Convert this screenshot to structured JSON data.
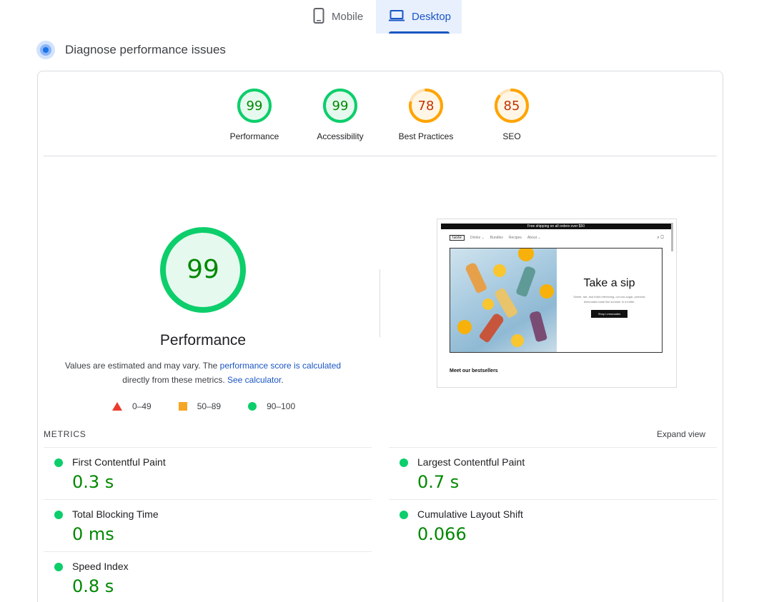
{
  "tabs": [
    {
      "label": "Mobile",
      "icon": "smartphone-icon"
    },
    {
      "label": "Desktop",
      "icon": "laptop-icon",
      "active": true
    }
  ],
  "diagnose": {
    "title": "Diagnose performance issues",
    "icon": "lighthouse-icon"
  },
  "categories": [
    {
      "score": "99",
      "label": "Performance",
      "value": 99,
      "color": "#0cce6b"
    },
    {
      "score": "99",
      "label": "Accessibility",
      "value": 99,
      "color": "#0cce6b"
    },
    {
      "score": "78",
      "label": "Best Practices",
      "value": 78,
      "color": "#ffa400"
    },
    {
      "score": "85",
      "label": "SEO",
      "value": 85,
      "color": "#ffa400"
    }
  ],
  "performance": {
    "score": "99",
    "value": 99,
    "title": "Performance",
    "desc_prefix": "Values are estimated and may vary. The ",
    "desc_link1": "performance score is calculated",
    "desc_middle": " directly from these metrics. ",
    "desc_link2": "See calculator",
    "desc_suffix": "."
  },
  "legend": [
    {
      "range": "0–49",
      "shape": "triangle"
    },
    {
      "range": "50–89",
      "shape": "square"
    },
    {
      "range": "90–100",
      "shape": "circle"
    }
  ],
  "screenshot": {
    "banner": "Free shipping on all orders over $50",
    "logo": "taste",
    "nav": [
      "Drinks ⌄",
      "Bundles",
      "Recipes",
      "About ⌄"
    ],
    "heading": "Take a sip",
    "body": "Sweet, tart, and thirst-refreshing, our low-sugar, probiotic lemonades taste like summer in a bottle.",
    "button": "Shop Lemonades",
    "footer_heading": "Meet our bestsellers"
  },
  "metrics": {
    "label": "METRICS",
    "expand": "Expand view",
    "items": [
      {
        "name": "First Contentful Paint",
        "value": "0.3 s"
      },
      {
        "name": "Largest Contentful Paint",
        "value": "0.7 s"
      },
      {
        "name": "Total Blocking Time",
        "value": "0 ms"
      },
      {
        "name": "Cumulative Layout Shift",
        "value": "0.066"
      },
      {
        "name": "Speed Index",
        "value": "0.8 s"
      }
    ]
  },
  "colors": {
    "pass": "#0cce6b",
    "average": "#ffa400",
    "fail": "#ff4e42",
    "accent": "#1a56c4"
  }
}
